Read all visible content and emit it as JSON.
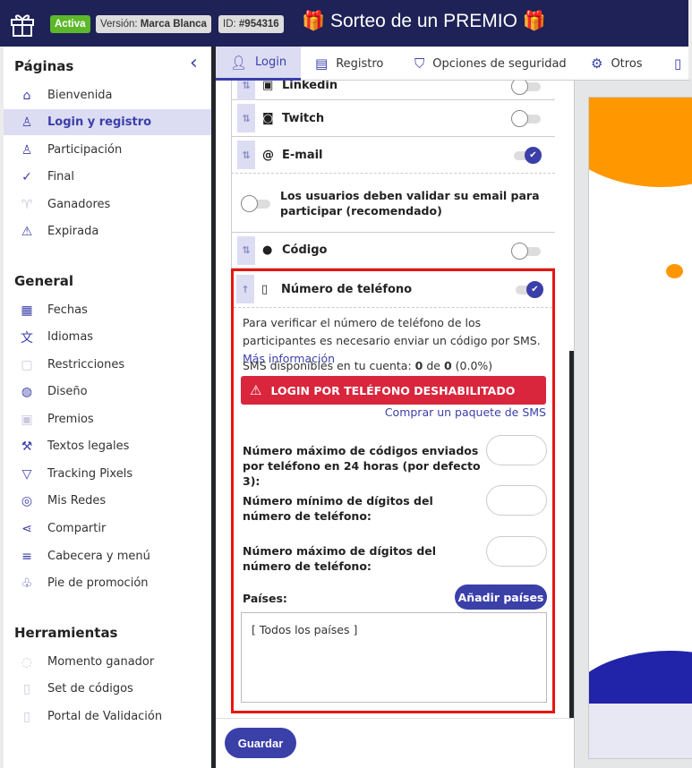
{
  "header": {
    "status": "Activa",
    "version_label": "Versión:",
    "version_value": "Marca Blanca",
    "id_label": "ID:",
    "id_value": "#954316",
    "title": "🎁 Sorteo de un PREMIO 🎁",
    "colors": {
      "bg": "#1e2257",
      "active": "#5cb82a"
    }
  },
  "sidebar": {
    "sections": [
      {
        "title": "Páginas",
        "items": [
          {
            "label": "Bienvenida",
            "icon": "home-icon"
          },
          {
            "label": "Login y registro",
            "icon": "user-login-icon",
            "active": true
          },
          {
            "label": "Participación",
            "icon": "user-add-icon"
          },
          {
            "label": "Final",
            "icon": "check-icon"
          },
          {
            "label": "Ganadores",
            "icon": "trophy-icon"
          },
          {
            "label": "Expirada",
            "icon": "warning-icon"
          }
        ]
      },
      {
        "title": "General",
        "items": [
          {
            "label": "Fechas",
            "icon": "calendar-icon"
          },
          {
            "label": "Idiomas",
            "icon": "translate-icon"
          },
          {
            "label": "Restricciones",
            "icon": "lock-icon"
          },
          {
            "label": "Diseño",
            "icon": "palette-icon"
          },
          {
            "label": "Premios",
            "icon": "gift-icon"
          },
          {
            "label": "Textos legales",
            "icon": "gavel-icon"
          },
          {
            "label": "Tracking Pixels",
            "icon": "filter-icon"
          },
          {
            "label": "Mis Redes",
            "icon": "globe-icon"
          },
          {
            "label": "Compartir",
            "icon": "share-icon"
          },
          {
            "label": "Cabecera y menú",
            "icon": "menu-icon"
          },
          {
            "label": "Pie de promoción",
            "icon": "foot-icon"
          }
        ]
      },
      {
        "title": "Herramientas",
        "items": [
          {
            "label": "Momento ganador",
            "icon": "stopwatch-icon"
          },
          {
            "label": "Set de códigos",
            "icon": "ticket-icon"
          },
          {
            "label": "Portal de Validación",
            "icon": "validate-icon"
          }
        ]
      }
    ]
  },
  "tabs": [
    {
      "label": "Login",
      "icon": "user-icon",
      "active": true
    },
    {
      "label": "Registro",
      "icon": "clipboard-icon"
    },
    {
      "label": "Opciones de seguridad",
      "icon": "shield-icon"
    },
    {
      "label": "Otros",
      "icon": "gear-icon"
    }
  ],
  "methods": [
    {
      "label": "Linkedin",
      "on": false
    },
    {
      "label": "Twitch",
      "on": false
    },
    {
      "label": "E-mail",
      "on": true
    },
    {
      "label": "Código",
      "on": false
    },
    {
      "label": "Número de teléfono",
      "on": true
    }
  ],
  "email_validate": {
    "label": "Los usuarios deben validar su email para participar (recomendado)",
    "on": false
  },
  "phone": {
    "desc": "Para verificar el número de teléfono de los participantes es necesario enviar un código por SMS.",
    "more_link": "Más información",
    "sms_prefix": "SMS disponibles en tu cuenta:",
    "sms_used": "0",
    "sms_of": "de",
    "sms_total": "0",
    "sms_pct": "(0.0%)",
    "alert": "LOGIN POR TELÉFONO DESHABILITADO",
    "buy_link": "Comprar un paquete de SMS",
    "fields": [
      {
        "label": "Número máximo de códigos enviados por teléfono en 24 horas (por defecto 3):",
        "value": ""
      },
      {
        "label": "Número mínimo de dígitos del número de teléfono:",
        "value": ""
      },
      {
        "label": "Número máximo de dígitos del número de teléfono:",
        "value": ""
      }
    ],
    "countries_label": "Países:",
    "add_countries": "Añadir países",
    "countries_value": "[ Todos los países ]"
  },
  "footer": {
    "save": "Guardar"
  },
  "colors": {
    "accent": "#3b3fa8",
    "alert": "#d9263d",
    "highlight": "#e8150f",
    "preview_orange": "#ff9800",
    "preview_blue": "#2123a8"
  }
}
